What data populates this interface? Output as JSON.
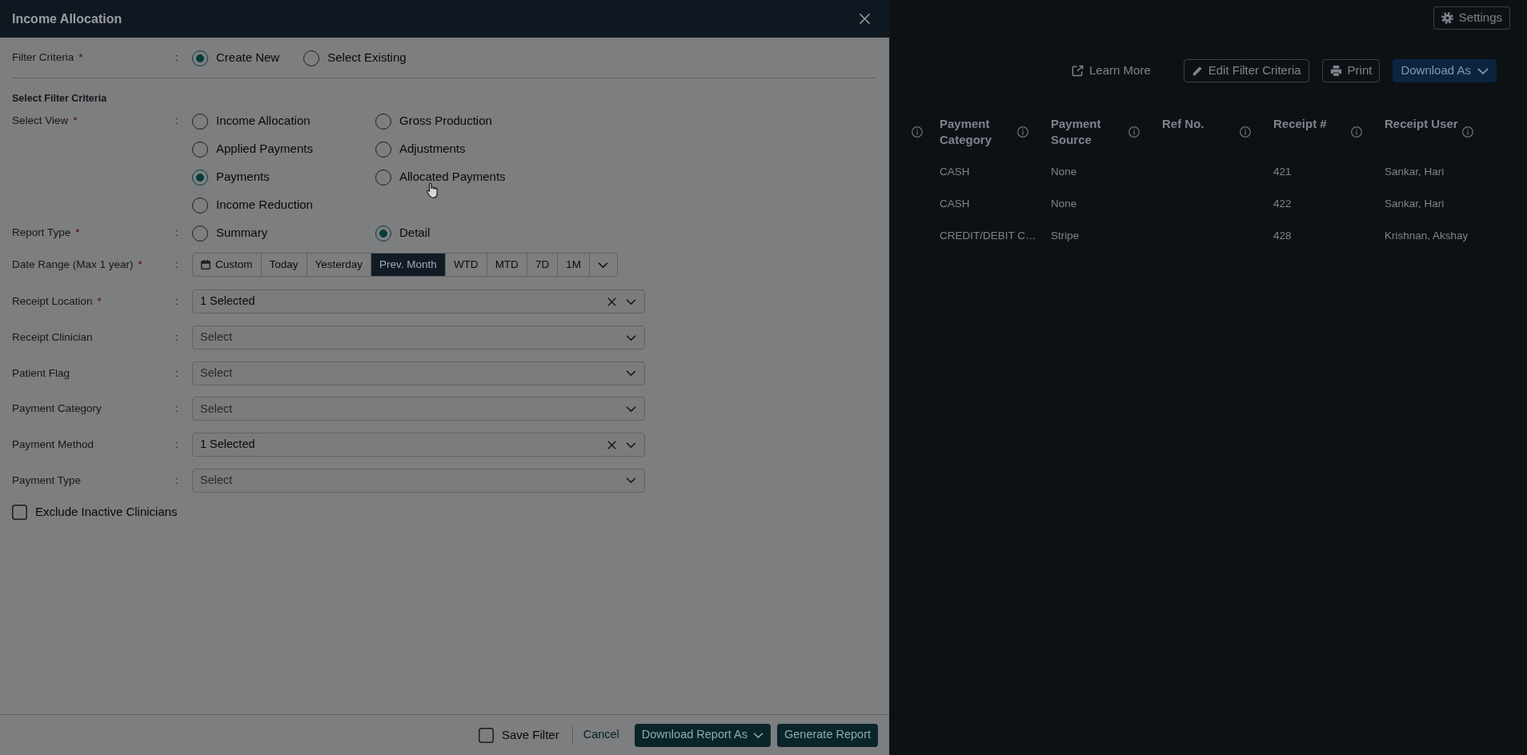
{
  "panel": {
    "title": "Income Allocation"
  },
  "filter_criteria": {
    "label": "Filter Criteria",
    "required_mark": "*",
    "colon": ":",
    "options": [
      {
        "label": "Create New",
        "selected": true
      },
      {
        "label": "Select Existing",
        "selected": false
      }
    ]
  },
  "section_heading": "Select Filter Criteria",
  "fields": [
    {
      "kind": "radio",
      "label": "Select View",
      "required_mark": "*",
      "colon": ":",
      "options": [
        {
          "label": "Income Allocation",
          "selected": false
        },
        {
          "label": "Gross Production",
          "selected": false
        },
        {
          "label": "Applied Payments",
          "selected": false
        },
        {
          "label": "Adjustments",
          "selected": false
        },
        {
          "label": "Payments",
          "selected": true
        },
        {
          "label": "Allocated Payments",
          "selected": false
        },
        {
          "label": "Income Reduction",
          "selected": false
        }
      ]
    },
    {
      "kind": "radio",
      "label": "Report Type",
      "required_mark": "*",
      "colon": ":",
      "options": [
        {
          "label": "Summary",
          "selected": false
        },
        {
          "label": "Detail",
          "selected": true
        }
      ]
    },
    {
      "kind": "range",
      "label": "Date Range (Max 1 year)",
      "required_mark": "*",
      "colon": ":",
      "buttons": [
        {
          "kind": "custom",
          "label": "Custom",
          "selected": false
        },
        {
          "kind": "preset",
          "label": "Today",
          "selected": false
        },
        {
          "kind": "preset",
          "label": "Yesterday",
          "selected": false
        },
        {
          "kind": "preset",
          "label": "Prev. Month",
          "selected": true
        },
        {
          "kind": "preset",
          "label": "WTD",
          "selected": false
        },
        {
          "kind": "preset",
          "label": "MTD",
          "selected": false
        },
        {
          "kind": "preset",
          "label": "7D",
          "selected": false
        },
        {
          "kind": "preset",
          "label": "1M",
          "selected": false
        },
        {
          "kind": "more",
          "selected": false
        }
      ]
    },
    {
      "kind": "select",
      "label": "Receipt Location",
      "required_mark": "*",
      "colon": ":",
      "value": "1 Selected"
    },
    {
      "kind": "select",
      "label": "Receipt Clinician",
      "colon": ":",
      "placeholder": "Select"
    },
    {
      "kind": "select",
      "label": "Patient Flag",
      "colon": ":",
      "placeholder": "Select"
    },
    {
      "kind": "select",
      "label": "Payment Category",
      "colon": ":",
      "placeholder": "Select"
    },
    {
      "kind": "select",
      "label": "Payment Method",
      "colon": ":",
      "value": "1 Selected"
    },
    {
      "kind": "select",
      "label": "Payment Type",
      "colon": ":",
      "placeholder": "Select"
    },
    {
      "kind": "checkbox",
      "label": "Exclude Inactive Clinicians",
      "checked": false
    }
  ],
  "footer": {
    "save_filter": {
      "label": "Save Filter",
      "checked": false
    },
    "cancel": "Cancel",
    "download": "Download Report As",
    "generate": "Generate Report"
  },
  "report_page": {
    "settings": "Settings",
    "actions": [
      {
        "kind": "link",
        "label": "Learn More"
      },
      {
        "kind": "edit",
        "label": "Edit Filter Criteria"
      },
      {
        "kind": "print",
        "label": "Print"
      },
      {
        "kind": "menu",
        "label": "Download As"
      }
    ],
    "table": {
      "columns": [
        {
          "kind": "cut"
        },
        {
          "kind": "text",
          "label": "Payment Category"
        },
        {
          "kind": "text",
          "label": "Payment Source"
        },
        {
          "kind": "text",
          "label": "Ref No."
        },
        {
          "kind": "text",
          "label": "Receipt #"
        },
        {
          "kind": "text",
          "label": "Receipt User"
        }
      ],
      "rows": [
        {
          "cells": [
            null,
            "CASH",
            "None",
            null,
            "421",
            "Sankar, Hari"
          ]
        },
        {
          "cells": [
            null,
            "CASH",
            "None",
            null,
            "422",
            "Sankar, Hari"
          ]
        },
        {
          "cells": [
            null,
            "CREDIT/DEBIT C…",
            "Stripe",
            null,
            "428",
            "Krishnan, Akshay"
          ]
        }
      ]
    }
  }
}
